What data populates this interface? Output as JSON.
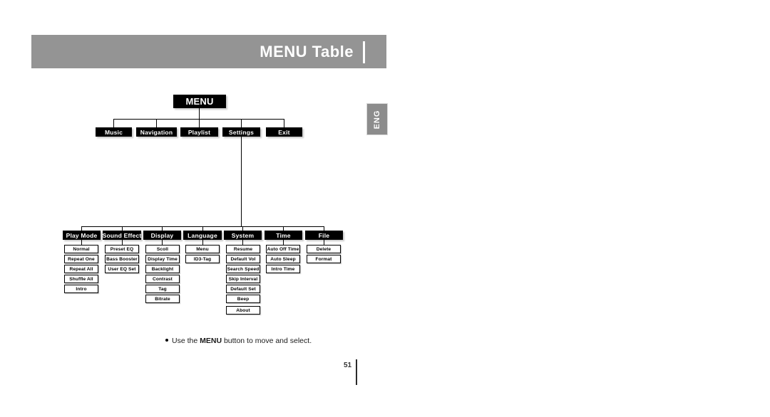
{
  "header": {
    "title": "MENU Table",
    "language_tab": "ENG"
  },
  "tree": {
    "root": {
      "label": "MENU"
    },
    "level1": [
      {
        "label": "Music"
      },
      {
        "label": "Navigation"
      },
      {
        "label": "Playlist"
      },
      {
        "label": "Settings"
      },
      {
        "label": "Exit"
      }
    ],
    "level2": [
      {
        "label": "Play Mode",
        "children": [
          "Normal",
          "Repeat One",
          "Repeat All",
          "Shuffle All",
          "Intro"
        ]
      },
      {
        "label": "Sound Effect",
        "children": [
          "Preset EQ",
          "Bass Booster",
          "User EQ Set"
        ]
      },
      {
        "label": "Display",
        "children": [
          "Scoll",
          "Display Time",
          "Backlight",
          "Contrast",
          "Tag",
          "Bitrate"
        ]
      },
      {
        "label": "Language",
        "children": [
          "Menu",
          "ID3-Tag"
        ]
      },
      {
        "label": "System",
        "children": [
          "Resume",
          "Default Vol",
          "Search Speed",
          "Skip Interval",
          "Default Set",
          "Beep",
          "About"
        ]
      },
      {
        "label": "Time",
        "children": [
          "Auto Off Time",
          "Auto Sleep",
          "Intro Time"
        ]
      },
      {
        "label": "File",
        "children": [
          "Delete",
          "Format"
        ]
      }
    ]
  },
  "footer": {
    "note_prefix": "Use the ",
    "note_emphasis": "MENU",
    "note_suffix": " button to move and select.",
    "page_number": "51"
  }
}
